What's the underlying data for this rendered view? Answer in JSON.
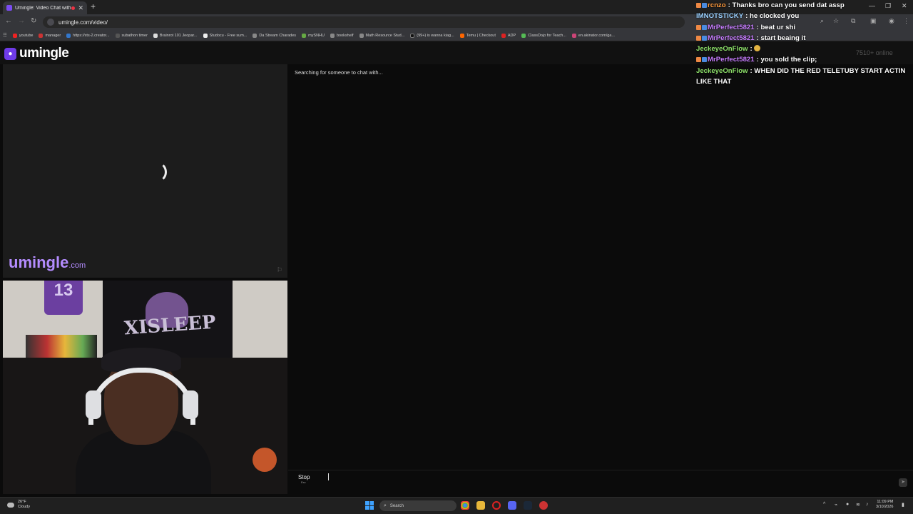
{
  "browser": {
    "tab_title": "Umingle: Video Chat with S",
    "url": "umingle.com/video/",
    "bookmarks": [
      "youtube",
      "manager",
      "https://xts-2.creator...",
      "subathon timer",
      "Brainrot 101 Jeopar...",
      "Studocu - Free sum...",
      "Da Stream Charades",
      "mySNHU",
      "bookshelf",
      "Math Resource Stud...",
      "(99+) is wanna kiag...",
      "Temu | Checkout",
      "ADP",
      "ClassDojo for Teach...",
      "en.akinator.com/ga..."
    ]
  },
  "site": {
    "logo": "umingle",
    "online_count": "7510+ online",
    "watermark_main": "umingle",
    "watermark_suffix": ".com",
    "status": "Searching for someone to chat with...",
    "stop_label": "Stop",
    "stop_hint": "Esc"
  },
  "webcam": {
    "jersey_number": "13",
    "poster_text": "XISLEEP"
  },
  "stream_chat": [
    {
      "user": "rcnzo",
      "text": "Thanks bro can you send dat assp",
      "color": "#ff9a3d"
    },
    {
      "user": "IMNOTSTICKY",
      "text": "he clocked you",
      "color": "#9ad0ff"
    },
    {
      "user": "MrPerfect5821",
      "text": "beat ur shi",
      "color": "#c77dff"
    },
    {
      "user": "MrPerfect5821",
      "text": "start beaing it",
      "color": "#c77dff"
    },
    {
      "user": "JeckeyeOnFlow",
      "text": "",
      "color": "#8fe36b"
    },
    {
      "user": "MrPerfect5821",
      "text": "you sold the clip;",
      "color": "#c77dff"
    },
    {
      "user": "JeckeyeOnFlow",
      "text": "WHEN DID THE RED TELETUBY START ACTIN LIKE THAT",
      "color": "#8fe36b"
    }
  ],
  "taskbar": {
    "weather_temp": "26°F",
    "weather_desc": "Cloudy",
    "search_placeholder": "Search",
    "time": "11:09 PM",
    "date": "3/10/2026"
  }
}
